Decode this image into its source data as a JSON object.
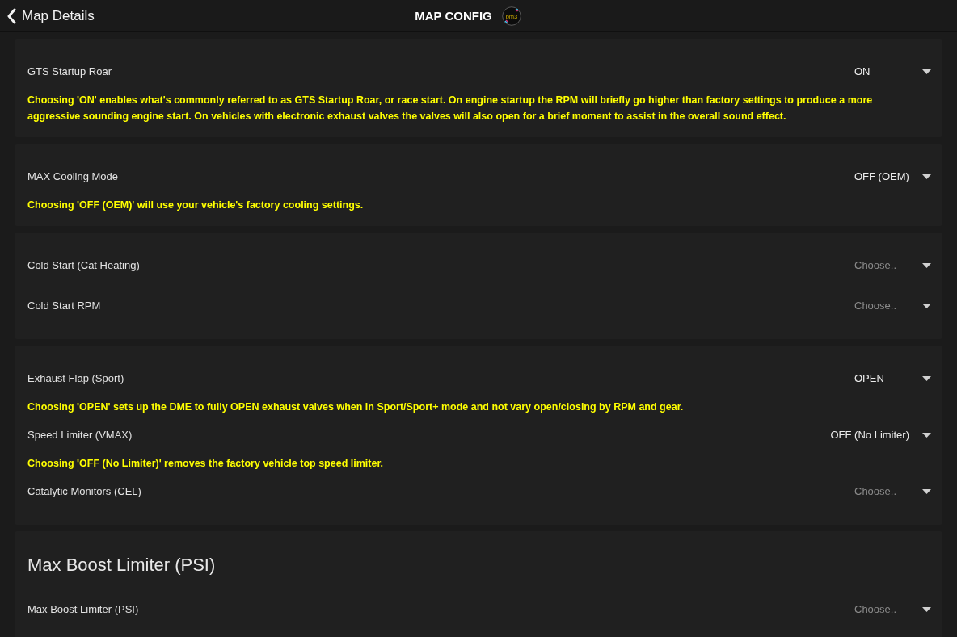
{
  "header": {
    "back_label": "Map Details",
    "title": "MAP CONFIG",
    "logo_text": "bm3"
  },
  "sections": [
    {
      "settings": [
        {
          "label": "GTS Startup Roar",
          "value": "ON",
          "description": "Choosing 'ON' enables what's commonly referred to as GTS Startup Roar, or race start. On engine startup the RPM will briefly go higher than factory settings to produce a more aggressive sounding engine start. On vehicles with electronic exhaust valves the valves will also open for a brief moment to assist in the overall sound effect."
        }
      ]
    },
    {
      "settings": [
        {
          "label": "MAX Cooling Mode",
          "value": "OFF (OEM)",
          "description": "Choosing 'OFF (OEM)' will use your vehicle's factory cooling settings."
        }
      ]
    },
    {
      "settings": [
        {
          "label": "Cold Start (Cat Heating)",
          "placeholder": "Choose.."
        },
        {
          "label": "Cold Start RPM",
          "placeholder": "Choose.."
        }
      ]
    },
    {
      "settings": [
        {
          "label": "Exhaust Flap (Sport)",
          "value": "OPEN",
          "description": "Choosing 'OPEN' sets up the DME to fully OPEN exhaust valves when in Sport/Sport+ mode and not vary open/closing by RPM and gear."
        },
        {
          "label": "Speed Limiter (VMAX)",
          "value": "OFF (No Limiter)",
          "description": "Choosing 'OFF (No Limiter)' removes the factory vehicle top speed limiter."
        },
        {
          "label": "Catalytic Monitors (CEL)",
          "placeholder": "Choose.."
        }
      ]
    },
    {
      "heading": "Max Boost Limiter (PSI)",
      "settings": [
        {
          "label": "Max Boost Limiter (PSI)",
          "placeholder": "Choose.."
        }
      ]
    }
  ]
}
